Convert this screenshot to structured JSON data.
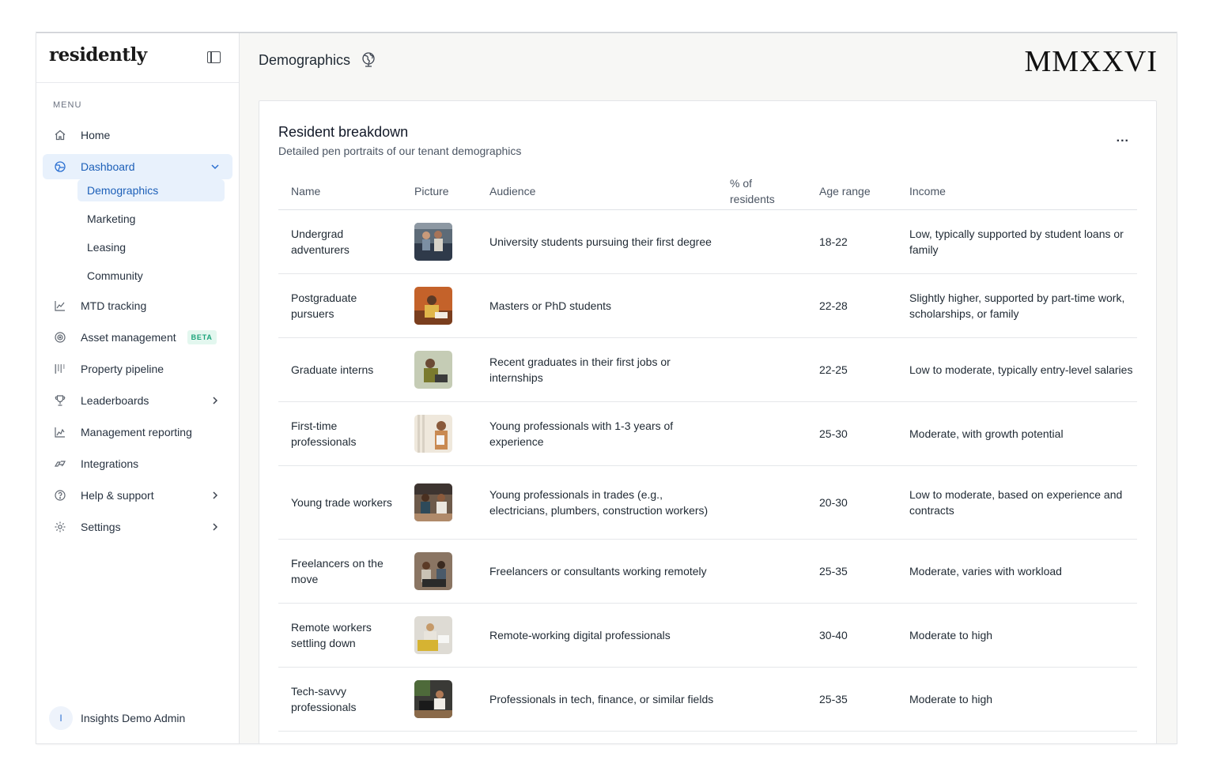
{
  "brand": "residently",
  "sidebar": {
    "menu_label": "MENU",
    "items": [
      {
        "label": "Home",
        "icon": "home-icon"
      },
      {
        "label": "Dashboard",
        "icon": "dashboard-icon",
        "expanded": true
      },
      {
        "label": "MTD tracking",
        "icon": "chart-line-icon"
      },
      {
        "label": "Asset management",
        "icon": "target-icon",
        "badge": "BETA"
      },
      {
        "label": "Property pipeline",
        "icon": "pipeline-icon"
      },
      {
        "label": "Leaderboards",
        "icon": "trophy-icon"
      },
      {
        "label": "Management reporting",
        "icon": "report-chart-icon"
      },
      {
        "label": "Integrations",
        "icon": "integrations-icon"
      },
      {
        "label": "Help & support",
        "icon": "help-icon"
      },
      {
        "label": "Settings",
        "icon": "gear-icon"
      }
    ],
    "dashboard_sub": [
      "Demographics",
      "Marketing",
      "Leasing",
      "Community"
    ],
    "user": {
      "initial": "I",
      "name": "Insights Demo Admin"
    }
  },
  "header": {
    "title": "Demographics",
    "year_mark": "MMXXVI"
  },
  "card": {
    "title": "Resident breakdown",
    "subtitle": "Detailed pen portraits of our tenant demographics",
    "more": "..."
  },
  "table": {
    "headers": {
      "name": "Name",
      "picture": "Picture",
      "audience": "Audience",
      "pct_line1": "% of",
      "pct_line2": "residents",
      "age": "Age range",
      "income": "Income"
    },
    "rows": [
      {
        "name": "Undergrad adventurers",
        "audience": "University students pursuing their first degree",
        "pct": "",
        "age": "18-22",
        "income": "Low, typically supported by student loans or family"
      },
      {
        "name": "Postgraduate pursuers",
        "audience": "Masters or PhD students",
        "pct": "",
        "age": "22-28",
        "income": "Slightly higher, supported by part-time work, scholarships, or family"
      },
      {
        "name": "Graduate interns",
        "audience": "Recent graduates in their first jobs or internships",
        "pct": "",
        "age": "22-25",
        "income": "Low to moderate, typically entry-level salaries"
      },
      {
        "name": "First-time professionals",
        "audience": "Young professionals with 1-3 years of experience",
        "pct": "",
        "age": "25-30",
        "income": "Moderate, with growth potential"
      },
      {
        "name": "Young trade workers",
        "audience": "Young professionals in trades (e.g., electricians, plumbers, construction workers)",
        "pct": "",
        "age": "20-30",
        "income": "Low to moderate, based on experience and contracts"
      },
      {
        "name": "Freelancers on the move",
        "audience": "Freelancers or consultants working remotely",
        "pct": "",
        "age": "25-35",
        "income": "Moderate, varies with workload"
      },
      {
        "name": "Remote workers settling down",
        "audience": "Remote-working digital professionals",
        "pct": "",
        "age": "30-40",
        "income": "Moderate to high"
      },
      {
        "name": "Tech-savvy professionals",
        "audience": "Professionals in tech, finance, or similar fields",
        "pct": "",
        "age": "25-35",
        "income": "Moderate to high"
      }
    ]
  },
  "colors": {
    "accent": "#2a6fd1",
    "active_bg": "#e8f1fc",
    "beta_text": "#1aa37a",
    "beta_bg": "#e3f7ef"
  }
}
